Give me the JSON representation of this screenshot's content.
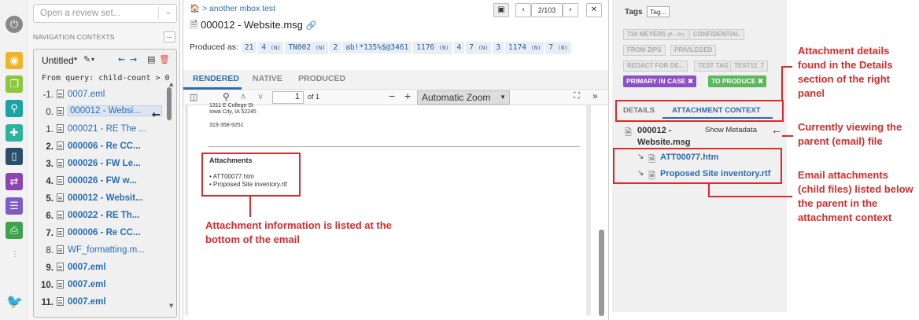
{
  "nav": {
    "review_placeholder": "Open a review set...",
    "contexts_label": "NAVIGATION CONTEXTS",
    "more_label": "...",
    "context_title": "Untitled*",
    "query": "From query: child-count > 0",
    "rows": [
      {
        "num": "-1.",
        "name": "0007.eml",
        "bold": false
      },
      {
        "num": "0.",
        "name": "000012 - Websi...",
        "bold": false
      },
      {
        "num": "1.",
        "name": "000021 - RE  The ...",
        "bold": false
      },
      {
        "num": "2.",
        "name": "000006 - Re  CC...",
        "bold": true
      },
      {
        "num": "3.",
        "name": "000026 - FW  Le...",
        "bold": true
      },
      {
        "num": "4.",
        "name": "000026 - FW  w...",
        "bold": true
      },
      {
        "num": "5.",
        "name": "000012 - Websit...",
        "bold": true
      },
      {
        "num": "6.",
        "name": "000022 - RE  Th...",
        "bold": true
      },
      {
        "num": "7.",
        "name": "000006 - Re  CC...",
        "bold": true
      },
      {
        "num": "8.",
        "name": "WF_formatting.m...",
        "bold": false
      },
      {
        "num": "9.",
        "name": "0007.eml",
        "bold": true
      },
      {
        "num": "10.",
        "name": "0007.eml",
        "bold": true
      },
      {
        "num": "11.",
        "name": "0007.eml",
        "bold": true
      }
    ]
  },
  "viewer": {
    "breadcrumb": "another mbox test",
    "title": "000012 - Website.msg",
    "page_counter": "2/103",
    "produced_label": "Produced as:",
    "tokens": [
      {
        "t": "21",
        "s": ""
      },
      {
        "t": "4",
        "s": "(N)"
      },
      {
        "t": "TN002",
        "s": "(N)"
      },
      {
        "t": "2",
        "s": ""
      },
      {
        "t": "ab!*135%$@3461",
        "s": ""
      },
      {
        "t": "1176",
        "s": "(N)"
      },
      {
        "t": "4",
        "s": ""
      },
      {
        "t": "7",
        "s": "(N)"
      },
      {
        "t": "3",
        "s": ""
      },
      {
        "t": "1174",
        "s": "(N)"
      },
      {
        "t": "7",
        "s": "(N)"
      }
    ],
    "tabs": {
      "rendered": "RENDERED",
      "native": "NATIVE",
      "produced": "PRODUCED"
    },
    "page_num": "1",
    "page_of": "of 1",
    "zoom": "Automatic Zoom",
    "address1": "1311 E College St",
    "address2": "Iowa City, IA 52245",
    "phone": "319-358-9251",
    "attachments_heading": "Attachments",
    "attachments": [
      "ATT00077.htm",
      "Proposed Site inventory.rtf"
    ]
  },
  "right": {
    "tags_label": "Tags",
    "tag_button": "Tag...",
    "tag_meyers": "734 MEYERS",
    "tag_meyers_sub": "(P – Pr)",
    "tags": [
      "CONFIDENTIAL",
      "FROM ZIPS",
      "PRIVILEGED",
      "REDACT FOR DE...",
      "TEST TAG",
      "TEST12_7"
    ],
    "active_tags": [
      {
        "label": "PRIMARY IN CASE",
        "color": "#8c4fc7"
      },
      {
        "label": "TO PRODUCE",
        "color": "#5cb85c"
      }
    ],
    "tab_details": "DETAILS",
    "tab_attach": "ATTACHMENT CONTEXT",
    "parent_name_1": "000012 -",
    "parent_name_2": "Website.msg",
    "show_metadata": "Show Metadata",
    "children": [
      "ATT00077.htm",
      "Proposed Site inventory.rtf"
    ]
  },
  "annotations": {
    "bottom": "Attachment information is listed at the bottom of the email",
    "details": "Attachment details found in the Details section of the right panel",
    "parent": "Currently viewing the parent (email) file",
    "children": "Email attachments (child files) listed below the parent in the attachment context"
  }
}
